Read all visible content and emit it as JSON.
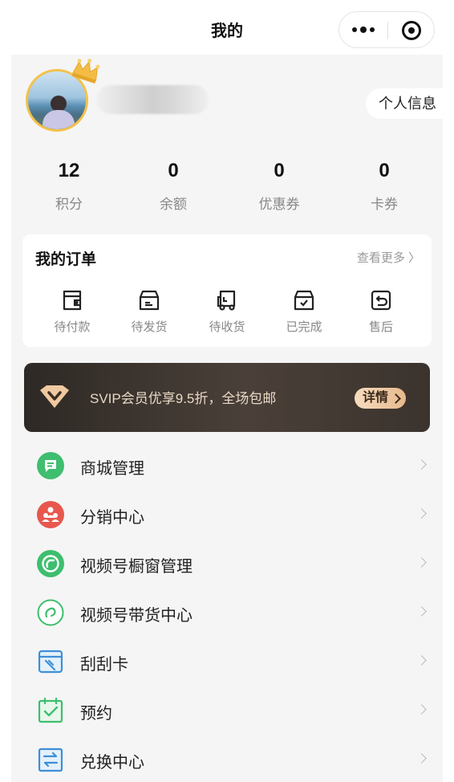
{
  "nav": {
    "title": "我的"
  },
  "profile": {
    "button_label": "个人信息"
  },
  "stats": [
    {
      "value": "12",
      "label": "积分"
    },
    {
      "value": "0",
      "label": "余额"
    },
    {
      "value": "0",
      "label": "优惠券"
    },
    {
      "value": "0",
      "label": "卡券"
    }
  ],
  "orders": {
    "title": "我的订单",
    "more_label": "查看更多 〉",
    "items": [
      {
        "label": "待付款",
        "icon": "wallet-icon"
      },
      {
        "label": "待发货",
        "icon": "box-icon"
      },
      {
        "label": "待收货",
        "icon": "truck-icon"
      },
      {
        "label": "已完成",
        "icon": "box-check-icon"
      },
      {
        "label": "售后",
        "icon": "return-icon"
      }
    ]
  },
  "svip": {
    "text": "SVIP会员优享9.5折，全场包邮",
    "button_label": "详情"
  },
  "menu": [
    {
      "label": "商城管理",
      "icon": "shop-manage-icon",
      "color": "#3ebe6e"
    },
    {
      "label": "分销中心",
      "icon": "distribution-icon",
      "color": "#e8574e"
    },
    {
      "label": "视频号橱窗管理",
      "icon": "video-window-icon",
      "color": "#3ebe6e"
    },
    {
      "label": "视频号带货中心",
      "icon": "video-sales-icon",
      "color": "#3ebe6e"
    },
    {
      "label": "刮刮卡",
      "icon": "scratch-card-icon",
      "color": "#3e8fd6"
    },
    {
      "label": "预约",
      "icon": "appointment-icon",
      "color": "#3ebe6e"
    },
    {
      "label": "兑换中心",
      "icon": "exchange-icon",
      "color": "#3e8fd6"
    }
  ],
  "colors": {
    "accent_green": "#3ebe6e",
    "accent_red": "#e8574e",
    "accent_blue": "#3e8fd6",
    "svip_gold": "#f0c9a0"
  }
}
